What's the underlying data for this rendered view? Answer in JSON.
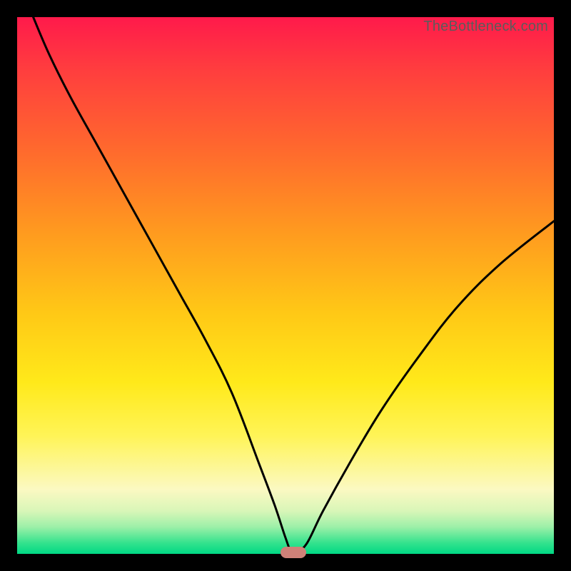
{
  "watermark": "TheBottleneck.com",
  "colors": {
    "frame": "#000000",
    "curve": "#000000",
    "marker": "#cf8178"
  },
  "chart_data": {
    "type": "line",
    "title": "",
    "xlabel": "",
    "ylabel": "",
    "xlim": [
      0,
      100
    ],
    "ylim": [
      0,
      100
    ],
    "grid": false,
    "legend": false,
    "series": [
      {
        "name": "bottleneck-curve",
        "x": [
          3,
          6,
          10,
          15,
          20,
          25,
          30,
          35,
          40,
          45,
          48,
          50,
          51,
          52,
          54,
          57,
          62,
          68,
          75,
          82,
          90,
          100
        ],
        "y": [
          100,
          93,
          85,
          76,
          67,
          58,
          49,
          40,
          30,
          17,
          9,
          3,
          0.5,
          0.3,
          2,
          8,
          17,
          27,
          37,
          46,
          54,
          62
        ]
      }
    ],
    "marker": {
      "x": 51.5,
      "y": 0.3
    },
    "background_gradient": {
      "orientation": "vertical",
      "stops": [
        {
          "pos": 0,
          "color": "#ff1a4b"
        },
        {
          "pos": 10,
          "color": "#ff3e3e"
        },
        {
          "pos": 25,
          "color": "#ff6a2d"
        },
        {
          "pos": 40,
          "color": "#ff9a1f"
        },
        {
          "pos": 55,
          "color": "#ffc816"
        },
        {
          "pos": 68,
          "color": "#ffe91a"
        },
        {
          "pos": 78,
          "color": "#fff457"
        },
        {
          "pos": 88,
          "color": "#fbf9c2"
        },
        {
          "pos": 92,
          "color": "#d9f6b8"
        },
        {
          "pos": 95,
          "color": "#9cf0a8"
        },
        {
          "pos": 98,
          "color": "#33e28d"
        },
        {
          "pos": 100,
          "color": "#00d884"
        }
      ]
    }
  }
}
